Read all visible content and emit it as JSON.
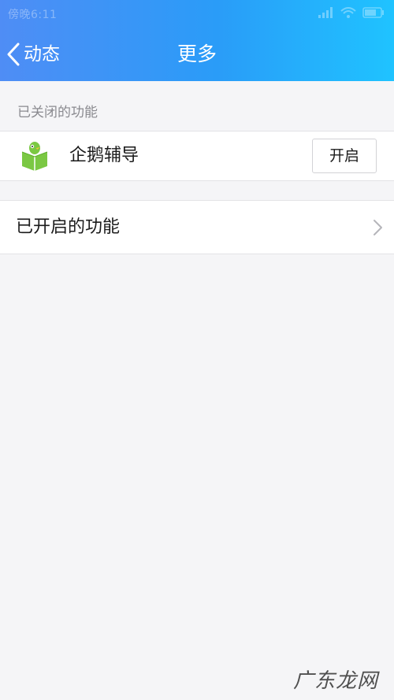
{
  "status_bar": {
    "time": "傍晚6:11",
    "icons": [
      "signal-icon",
      "wifi-icon",
      "battery-icon"
    ]
  },
  "nav": {
    "back_label": "动态",
    "title": "更多"
  },
  "closed_section": {
    "label": "已关闭的功能",
    "items": [
      {
        "icon": "penguin-tutor-icon",
        "label": "企鹅辅导",
        "button": "开启"
      }
    ]
  },
  "opened_section": {
    "label": "已开启的功能"
  },
  "watermark": {
    "text": "广东龙网"
  },
  "colors": {
    "header_start": "#4f8df5",
    "header_end": "#1fc3ff",
    "icon_green": "#7bc843"
  }
}
